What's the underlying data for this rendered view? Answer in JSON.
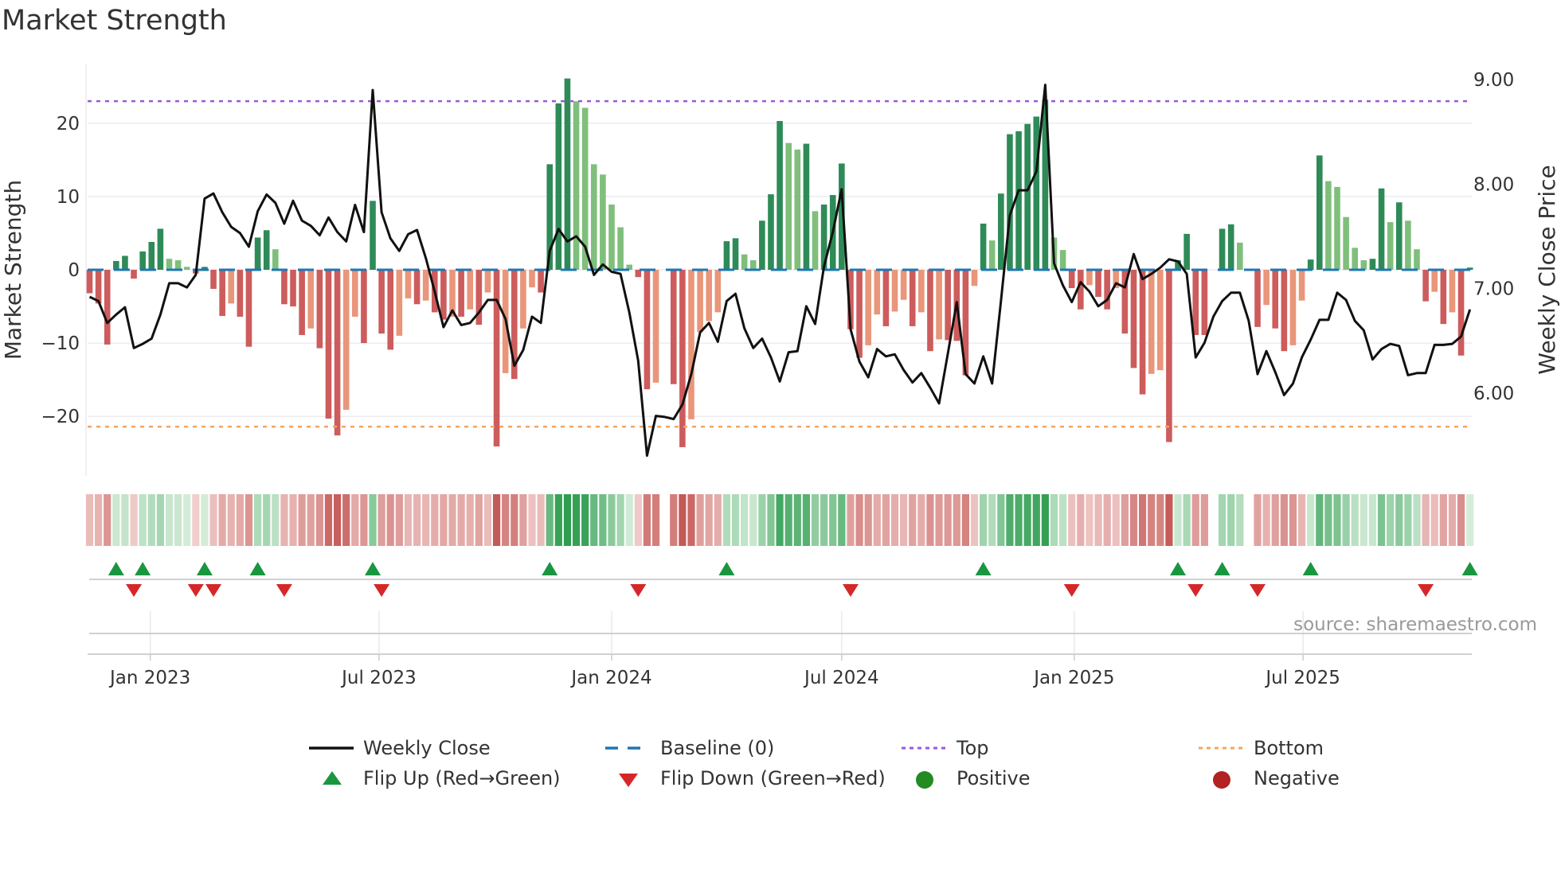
{
  "title": "Market Strength",
  "source": "source: sharemaestro.com",
  "colors": {
    "bar_up_strong": "#2e8b57",
    "bar_up_weak": "#7fbf7b",
    "bar_down_strong": "#cd5c5c",
    "bar_down_weak": "#e9967a",
    "close_line": "#111111",
    "baseline": "#1f77b4",
    "top": "#9b59d6",
    "bottom": "#f4a460",
    "flip_up": "#1a9641",
    "flip_down": "#d62728",
    "positive": "#228b22",
    "negative": "#b22222"
  },
  "chart_data": {
    "type": "bar+line",
    "title": "Market Strength",
    "ylabel": "Market Strength",
    "y2label": "Weekly Close Price",
    "start_date": "2022-11-14",
    "frequency": "weekly",
    "ylim": [
      -28,
      28
    ],
    "y2lim": [
      5.21,
      9.14
    ],
    "top": 23.0,
    "bottom": -21.4,
    "baseline": 0,
    "yticks": [
      20,
      10,
      0,
      -10,
      -20
    ],
    "ytick_labels": [
      "20",
      "10",
      "0",
      "−10",
      "−20"
    ],
    "y2ticks": [
      9,
      8,
      7,
      6
    ],
    "y2tick_labels": [
      "9.00",
      "8.00",
      "7.00",
      "6.00"
    ],
    "xticks": [
      {
        "label": "Jan 2023",
        "date": "2023-01-01"
      },
      {
        "label": "Jul 2023",
        "date": "2023-07-01"
      },
      {
        "label": "Jan 2024",
        "date": "2024-01-01"
      },
      {
        "label": "Jul 2024",
        "date": "2024-07-01"
      },
      {
        "label": "Jan 2025",
        "date": "2025-01-01"
      },
      {
        "label": "Jul 2025",
        "date": "2025-07-01"
      }
    ],
    "strength": [
      -3.2,
      -4.6,
      -10.2,
      1.2,
      1.9,
      -1.2,
      2.5,
      3.8,
      5.6,
      1.5,
      1.3,
      0.4,
      -0.5,
      0.4,
      -2.6,
      -6.3,
      -4.6,
      -6.4,
      -10.5,
      4.4,
      5.4,
      2.8,
      -4.7,
      -5.0,
      -8.9,
      -8.0,
      -10.7,
      -20.3,
      -22.6,
      -19.1,
      -6.4,
      -10.0,
      9.4,
      -8.7,
      -10.9,
      -9.0,
      -3.9,
      -4.7,
      -4.2,
      -5.8,
      -6.8,
      -6.4,
      -6.4,
      -5.4,
      -7.5,
      -3.1,
      -24.1,
      -14.1,
      -14.9,
      -8.0,
      -2.4,
      -3.1,
      14.4,
      22.7,
      26.1,
      23.0,
      22.1,
      14.4,
      13.0,
      8.9,
      5.8,
      0.7,
      -1.0,
      -16.3,
      -15.4,
      0,
      -15.6,
      -24.2,
      -20.4,
      -8.5,
      -7.0,
      -5.8,
      3.9,
      4.3,
      2.1,
      1.3,
      6.7,
      10.3,
      20.3,
      17.3,
      16.4,
      17.2,
      8.0,
      8.9,
      10.2,
      14.5,
      -8.1,
      -12.0,
      -10.3,
      -6.1,
      -7.7,
      -5.7,
      -4.1,
      -7.7,
      -5.8,
      -11.1,
      -9.5,
      -9.6,
      -9.7,
      -14.4,
      -2.2,
      6.3,
      4.0,
      10.4,
      18.5,
      18.9,
      19.9,
      20.9,
      23.2,
      4.4,
      2.7,
      -2.5,
      -5.4,
      -2.1,
      -3.7,
      -5.4,
      -2.5,
      -8.7,
      -13.4,
      -17.0,
      -14.2,
      -13.7,
      -23.5,
      1.3,
      4.9,
      -8.9,
      -8.9,
      0,
      5.6,
      6.2,
      3.7,
      0,
      -7.8,
      -4.8,
      -8.0,
      -11.1,
      -10.3,
      -4.2,
      1.4,
      15.6,
      12.1,
      11.3,
      7.2,
      3.0,
      1.3,
      1.5,
      11.1,
      6.5,
      9.2,
      6.7,
      2.8,
      -4.3,
      -3.0,
      -7.4,
      -5.8,
      -11.7,
      0.3
    ],
    "close": [
      6.92,
      6.88,
      6.67,
      6.75,
      6.82,
      6.43,
      6.47,
      6.52,
      6.75,
      7.05,
      7.05,
      7.01,
      7.13,
      7.86,
      7.91,
      7.73,
      7.59,
      7.53,
      7.4,
      7.74,
      7.9,
      7.82,
      7.62,
      7.84,
      7.65,
      7.6,
      7.51,
      7.68,
      7.54,
      7.45,
      7.8,
      7.54,
      8.9,
      7.73,
      7.48,
      7.36,
      7.52,
      7.56,
      7.29,
      6.97,
      6.63,
      6.79,
      6.65,
      6.67,
      6.77,
      6.89,
      6.89,
      6.71,
      6.26,
      6.41,
      6.73,
      6.67,
      7.36,
      7.57,
      7.45,
      7.5,
      7.4,
      7.13,
      7.23,
      7.16,
      7.14,
      6.77,
      6.31,
      5.4,
      5.78,
      5.77,
      5.75,
      5.89,
      6.18,
      6.58,
      6.67,
      6.49,
      6.88,
      6.95,
      6.62,
      6.43,
      6.52,
      6.34,
      6.11,
      6.39,
      6.4,
      6.83,
      6.66,
      7.21,
      7.54,
      7.95,
      6.61,
      6.3,
      6.15,
      6.42,
      6.35,
      6.37,
      6.22,
      6.1,
      6.19,
      6.05,
      5.9,
      6.38,
      6.87,
      6.18,
      6.09,
      6.35,
      6.09,
      6.88,
      7.7,
      7.94,
      7.94,
      8.12,
      8.95,
      7.24,
      7.03,
      6.87,
      7.06,
      6.97,
      6.83,
      6.89,
      7.05,
      7.01,
      7.33,
      7.09,
      7.14,
      7.2,
      7.28,
      7.26,
      7.14,
      6.34,
      6.48,
      6.73,
      6.88,
      6.96,
      6.96,
      6.69,
      6.18,
      6.4,
      6.2,
      5.98,
      6.09,
      6.34,
      6.51,
      6.7,
      6.7,
      6.96,
      6.89,
      6.69,
      6.6,
      6.32,
      6.42,
      6.47,
      6.45,
      6.17,
      6.19,
      6.19,
      6.46,
      6.46,
      6.47,
      6.54,
      6.8
    ]
  },
  "legend": [
    {
      "label": "Weekly Close",
      "symbol": "solid-line"
    },
    {
      "label": "Baseline (0)",
      "symbol": "dashed-line"
    },
    {
      "label": "Top",
      "symbol": "dotted-line"
    },
    {
      "label": "Bottom",
      "symbol": "dotted-line"
    },
    {
      "label": "Flip Up (Red→Green)",
      "symbol": "triangle-up"
    },
    {
      "label": "Flip Down (Green→Red)",
      "symbol": "triangle-down"
    },
    {
      "label": "Positive",
      "symbol": "circle"
    },
    {
      "label": "Negative",
      "symbol": "circle"
    }
  ]
}
